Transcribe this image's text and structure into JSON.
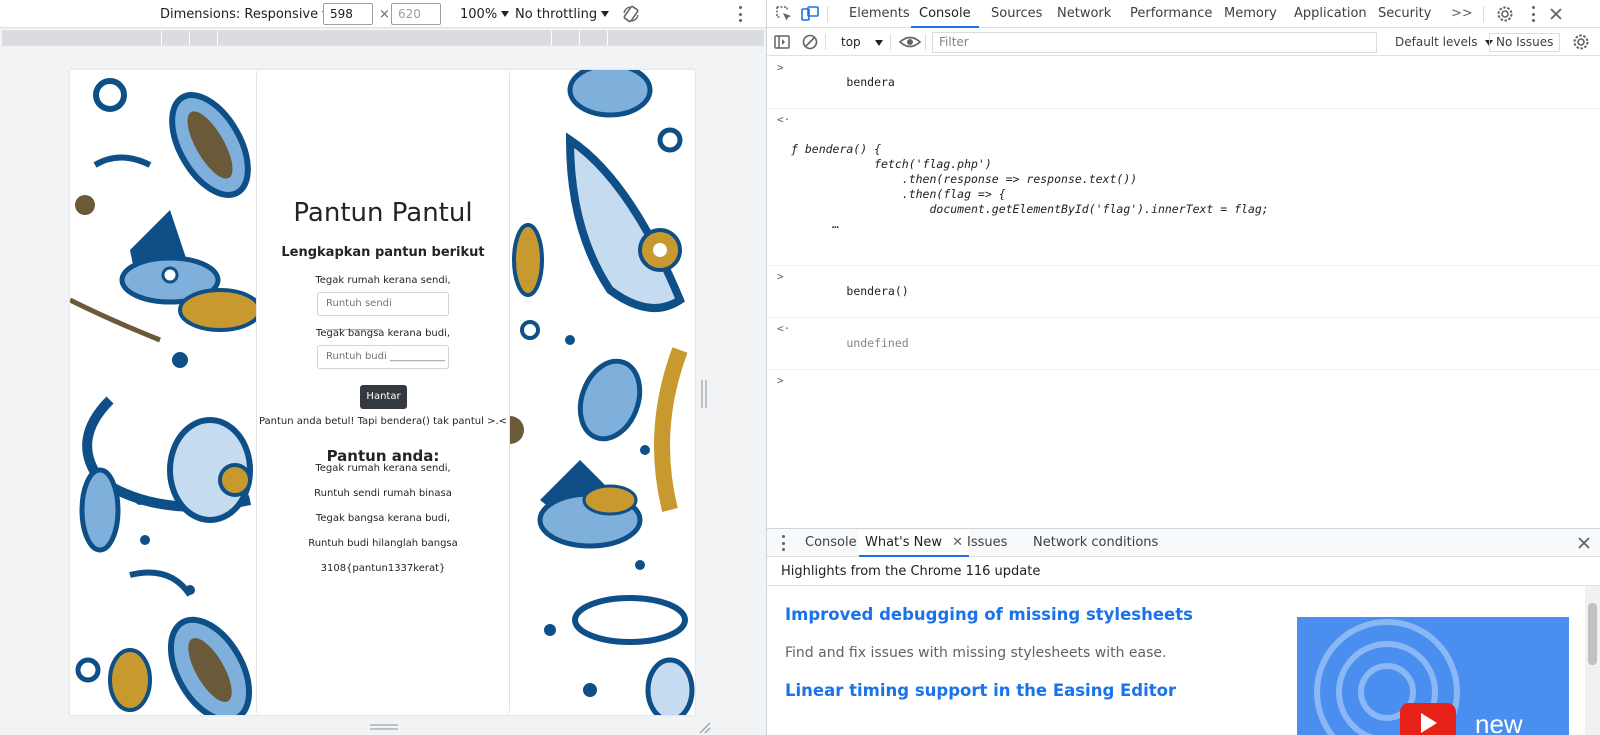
{
  "device_toolbar": {
    "dimensions_label": "Dimensions: Responsive",
    "width_value": "598",
    "times_sign": "×",
    "height_placeholder": "620",
    "zoom": "100%",
    "throttling": "No throttling"
  },
  "page": {
    "title": "Pantun Pantul",
    "subtitle": "Lengkapkan pantun berikut",
    "line1": "Tegak rumah kerana sendi,",
    "input1_placeholder": "Runtuh sendi ___________",
    "line2": "Tegak bangsa kerana budi,",
    "input2_placeholder": "Runtuh budi ___________",
    "submit_label": "Hantar",
    "result_message": "Pantun anda betul! Tapi bendera() tak pantul >.<",
    "pantun_heading": "Pantun anda:",
    "pantun_lines": [
      "Tegak rumah kerana sendi,",
      "Runtuh sendi rumah binasa",
      "Tegak bangsa kerana budi,",
      "Runtuh budi hilanglah bangsa",
      "3108{pantun1337kerat}"
    ]
  },
  "devtools": {
    "tabs": [
      "Elements",
      "Console",
      "Sources",
      "Network",
      "Performance",
      "Memory",
      "Application",
      "Security"
    ],
    "active_tab": "Console",
    "more_tabs": ">>",
    "context": "top",
    "filter_placeholder": "Filter",
    "levels": "Default levels",
    "issues": "No Issues",
    "console": {
      "cmd1": "bendera",
      "fn_line1": "ƒ bendera() {",
      "fn_line2": "            fetch('flag.php')",
      "fn_line3": "                .then(response => response.text())",
      "fn_line4": "                .then(flag => {",
      "fn_line5": "                    document.getElementById('flag').innerText = flag;",
      "fn_ellipsis": "      …",
      "cmd2": "bendera()",
      "result2": "undefined"
    },
    "drawer": {
      "tabs": [
        "Console",
        "What's New",
        "Issues",
        "Network conditions"
      ],
      "active_tab": "What's New",
      "highlights": "Highlights from the Chrome 116 update",
      "item1_title": "Improved debugging of missing stylesheets",
      "item1_desc": "Find and fix issues with missing stylesheets with ease.",
      "item2_title": "Linear timing support in the Easing Editor",
      "thumb_badge": "new"
    }
  },
  "colors": {
    "accent": "#1a73e8",
    "batik_navy": "#0d4f86",
    "batik_mustard": "#c8992e",
    "batik_light": "#7fb0dc"
  }
}
